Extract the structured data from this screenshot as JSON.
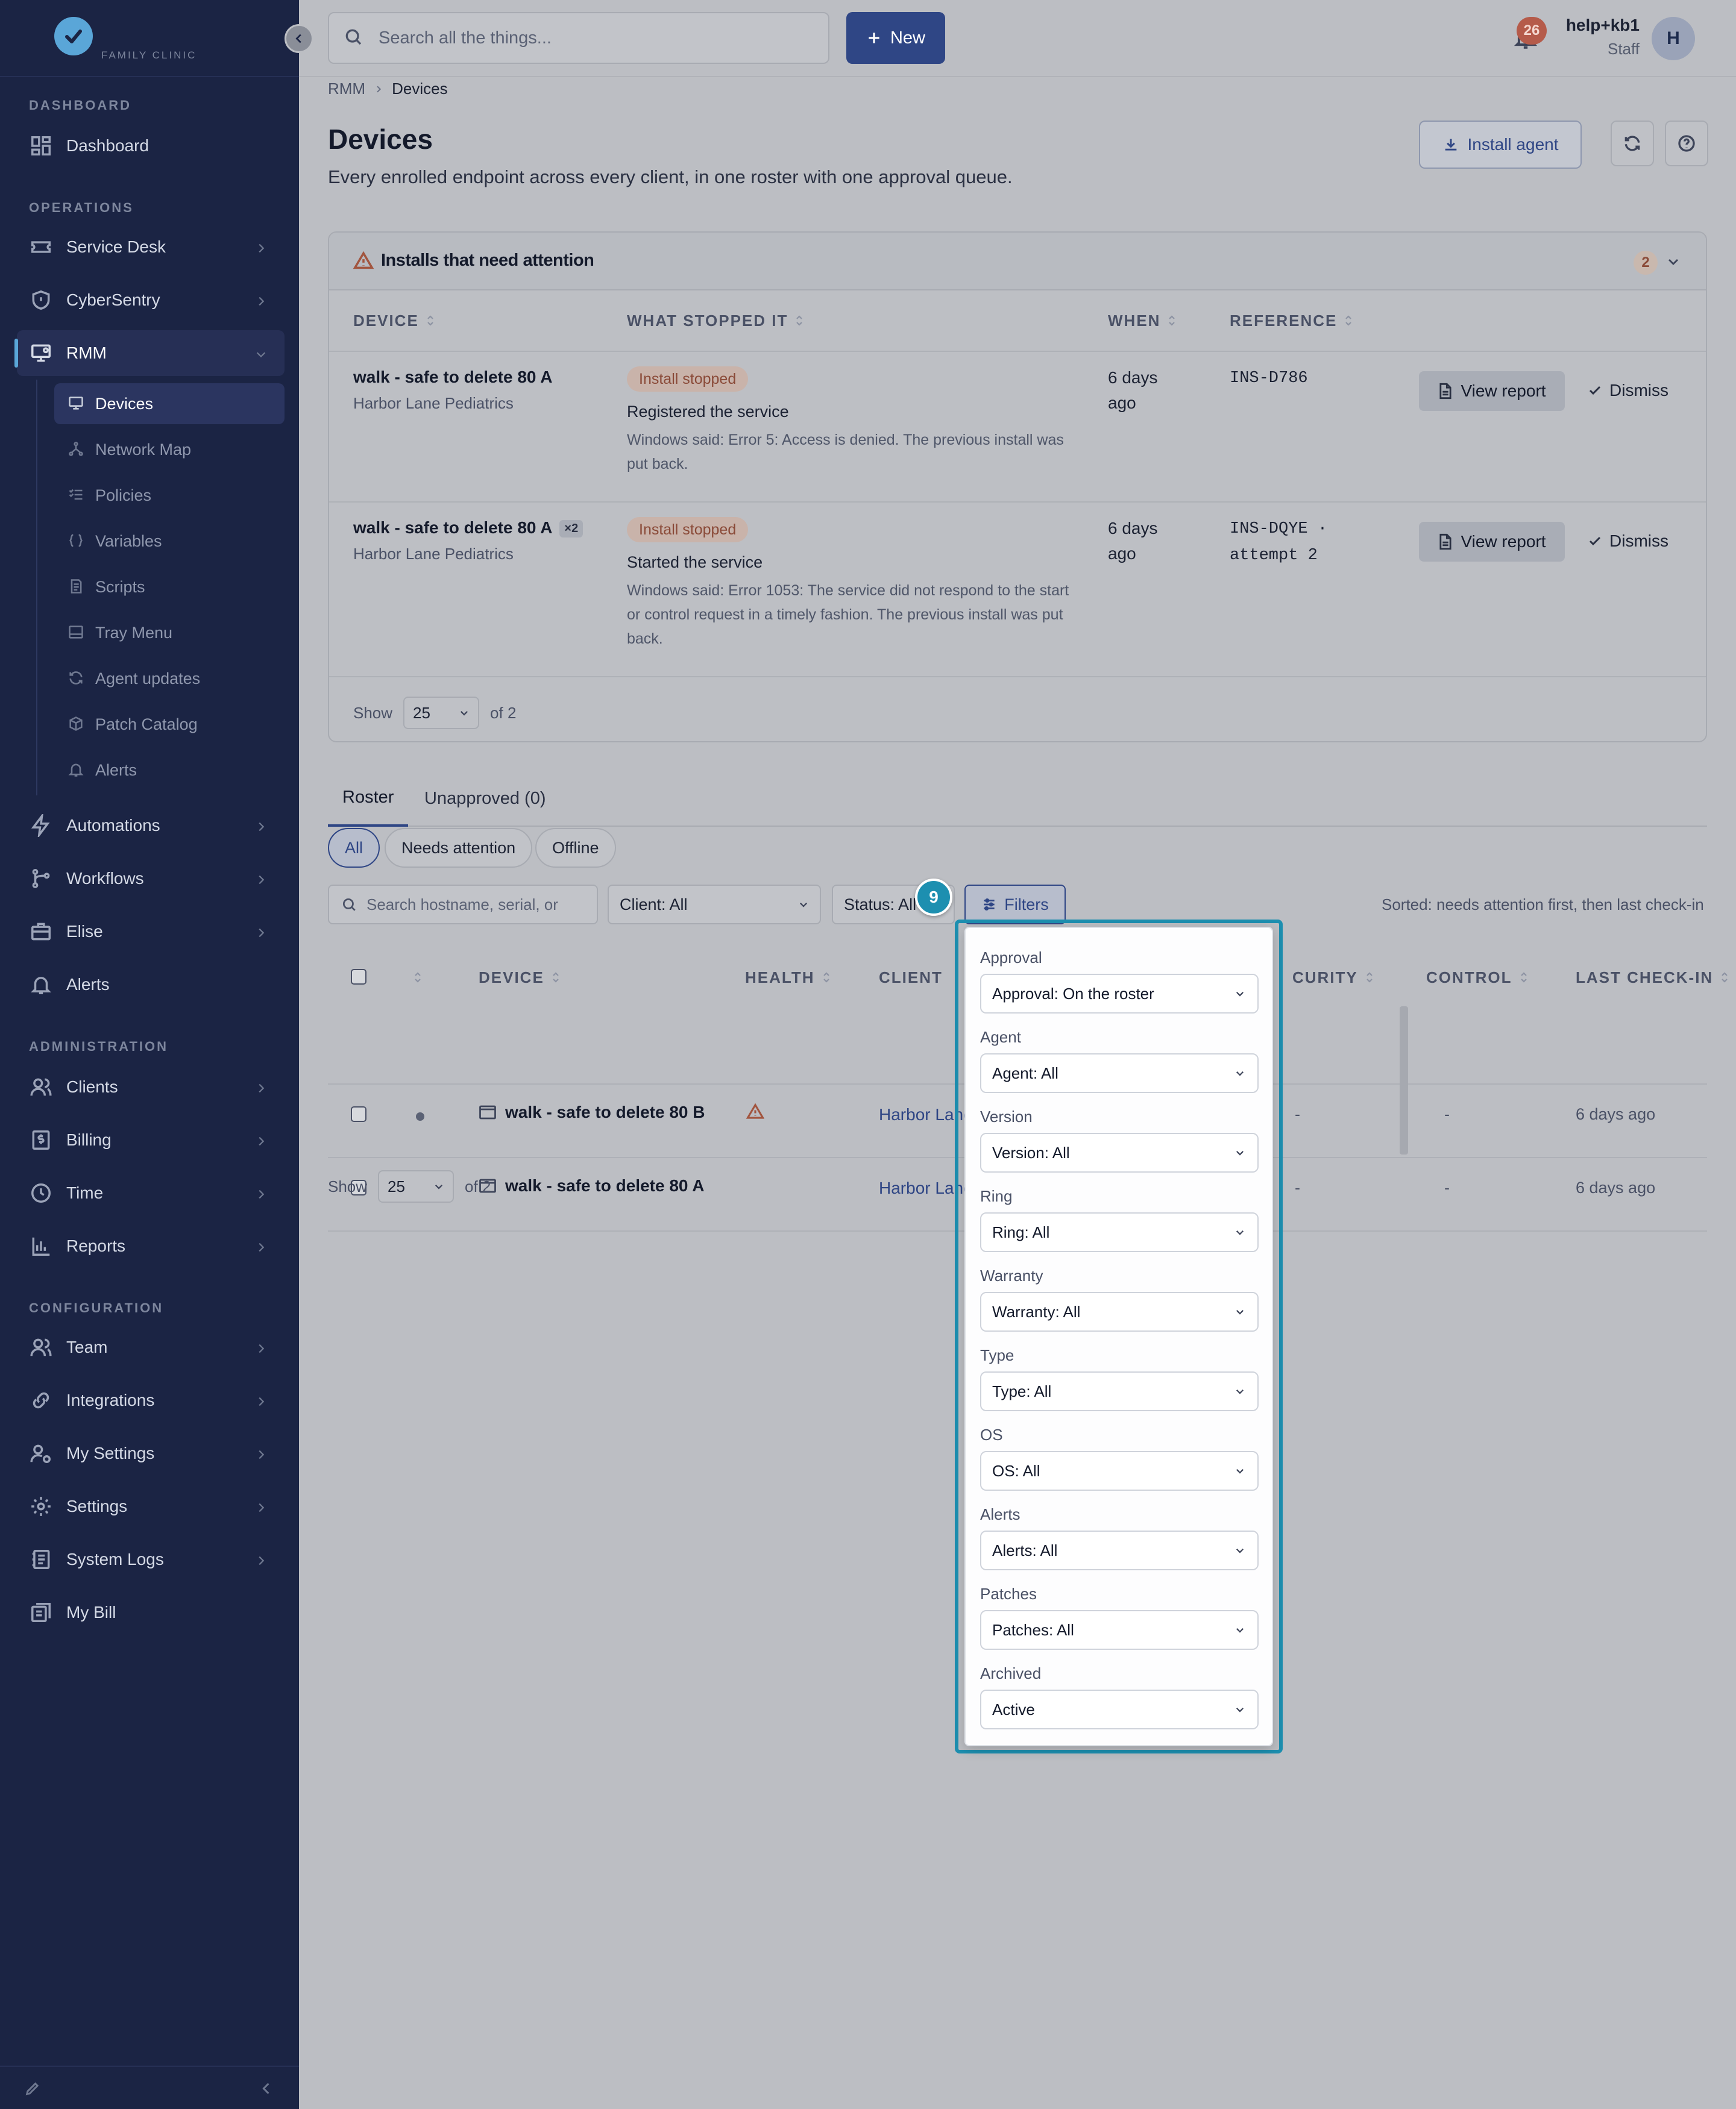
{
  "brand": {
    "logo_text": "FAMILY CLINIC"
  },
  "sidebar": {
    "sections": {
      "dashboard": "DASHBOARD",
      "operations": "OPERATIONS",
      "administration": "ADMINISTRATION",
      "configuration": "CONFIGURATION"
    },
    "items": {
      "dashboard": "Dashboard",
      "service_desk": "Service Desk",
      "cybersentry": "CyberSentry",
      "rmm": "RMM",
      "automations": "Automations",
      "workflows": "Workflows",
      "elise": "Elise",
      "alerts": "Alerts",
      "clients": "Clients",
      "billing": "Billing",
      "time": "Time",
      "reports": "Reports",
      "team": "Team",
      "integrations": "Integrations",
      "my_settings": "My Settings",
      "settings": "Settings",
      "system_logs": "System Logs",
      "my_bill": "My Bill"
    },
    "rmm_sub": {
      "devices": "Devices",
      "network_map": "Network Map",
      "policies": "Policies",
      "variables": "Variables",
      "scripts": "Scripts",
      "tray_menu": "Tray Menu",
      "agent_updates": "Agent updates",
      "patch_catalog": "Patch Catalog",
      "alerts": "Alerts"
    }
  },
  "topbar": {
    "search_placeholder": "Search all the things...",
    "new_label": "New",
    "notification_count": "26",
    "user_name": "help+kb1",
    "user_role": "Staff",
    "avatar_initial": "H"
  },
  "breadcrumb": {
    "parent": "RMM",
    "current": "Devices"
  },
  "page": {
    "title": "Devices",
    "subtitle": "Every enrolled endpoint across every client, in one roster with one approval queue.",
    "install_agent": "Install agent"
  },
  "attention": {
    "title": "Installs that need attention",
    "count": "2",
    "columns": {
      "device": "DEVICE",
      "what_stopped": "WHAT STOPPED IT",
      "when": "WHEN",
      "reference": "REFERENCE"
    },
    "rows": [
      {
        "device": "walk - safe to delete 80 A",
        "multiplier": "",
        "client": "Harbor Lane Pediatrics",
        "status": "Install stopped",
        "stage": "Registered the service",
        "detail": "Windows said: Error 5: Access is denied. The previous install was put back.",
        "when": "6 days ago",
        "reference": "INS-D786",
        "view_label": "View report",
        "dismiss_label": "Dismiss"
      },
      {
        "device": "walk - safe to delete 80 A",
        "multiplier": "×2",
        "client": "Harbor Lane Pediatrics",
        "status": "Install stopped",
        "stage": "Started the service",
        "detail": "Windows said: Error 1053: The service did not respond to the start or control request in a timely fashion. The previous install was put back.",
        "when": "6 days ago",
        "reference": "INS-DQYE · attempt 2",
        "view_label": "View report",
        "dismiss_label": "Dismiss"
      }
    ],
    "pager": {
      "show": "Show",
      "size": "25",
      "of": "of 2"
    }
  },
  "tabs": {
    "roster": "Roster",
    "unapproved": "Unapproved (0)"
  },
  "chips": {
    "all": "All",
    "needs_attention": "Needs attention",
    "offline": "Offline"
  },
  "filters": {
    "search_placeholder": "Search hostname, serial, or",
    "client": "Client: All",
    "status": "Status: All",
    "button": "Filters",
    "sorted_note": "Sorted: needs attention first, then last check-in"
  },
  "roster": {
    "columns": {
      "device": "DEVICE",
      "health": "HEALTH",
      "client": "CLIENT",
      "security": "CURITY",
      "control": "CONTROL",
      "last_checkin": "LAST CHECK-IN"
    },
    "rows": [
      {
        "device": "walk - safe to delete 80 B",
        "client": "Harbor Lane Pediatrics",
        "security": "-",
        "control": "-",
        "last_checkin": "6 days ago"
      },
      {
        "device": "walk - safe to delete 80 A",
        "client": "Harbor Lane Pediatrics",
        "security": "-",
        "control": "-",
        "last_checkin": "6 days ago"
      }
    ],
    "pager": {
      "show": "Show",
      "size": "25",
      "of": "of 2"
    }
  },
  "popover": {
    "step": "9",
    "fields": [
      {
        "label": "Approval",
        "value": "Approval: On the roster"
      },
      {
        "label": "Agent",
        "value": "Agent: All"
      },
      {
        "label": "Version",
        "value": "Version: All"
      },
      {
        "label": "Ring",
        "value": "Ring: All"
      },
      {
        "label": "Warranty",
        "value": "Warranty: All"
      },
      {
        "label": "Type",
        "value": "Type: All"
      },
      {
        "label": "OS",
        "value": "OS: All"
      },
      {
        "label": "Alerts",
        "value": "Alerts: All"
      },
      {
        "label": "Patches",
        "value": "Patches: All"
      },
      {
        "label": "Archived",
        "value": "Active"
      }
    ]
  },
  "colors": {
    "sidebar": "#1b2444",
    "accent": "#2f4685",
    "highlight": "#1d8fb0",
    "warning": "#a2553f"
  }
}
